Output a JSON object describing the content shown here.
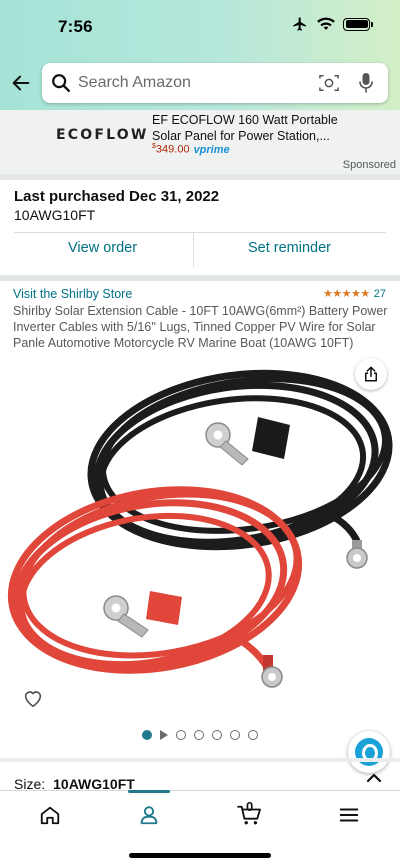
{
  "status_bar": {
    "time": "7:56",
    "icons": [
      "airplane-icon",
      "wifi-icon",
      "battery-icon"
    ]
  },
  "search": {
    "placeholder": "Search Amazon"
  },
  "ad": {
    "brand_logo": "ECOFLOW",
    "title": "EF ECOFLOW 160 Watt Portable Solar Panel for Power Station,...",
    "price_symbol": "$",
    "price": "349.00",
    "prime_label": "vprime",
    "sponsored_label": "Sponsored"
  },
  "last_purchase": {
    "title": "Last purchased Dec 31, 2022",
    "item": "10AWG10FT",
    "view_order": "View order",
    "set_reminder": "Set reminder"
  },
  "product": {
    "store_link": "Visit the Shirlby Store",
    "stars": "★★★★★",
    "rating": 4.6,
    "review_count": "27",
    "title": "Shirlby Solar Extension Cable - 10FT 10AWG(6mm²) Battery Power Inverter Cables with 5/16'' Lugs, Tinned Copper PV Wire for Solar Panle Automotive Motorcycle RV Marine Boat (10AWG 10FT)",
    "image_count": 6,
    "active_image": 0
  },
  "size": {
    "label": "Size:",
    "value": "10AWG10FT"
  },
  "tabbar": {
    "tabs": [
      "home-icon",
      "account-icon",
      "cart-icon",
      "menu-icon"
    ],
    "active_tab": "account-icon",
    "cart_count": "0"
  },
  "colors": {
    "link": "#007185",
    "price": "#b12704",
    "star": "#de7921",
    "accent": "#1f7a8c",
    "header_gradient": [
      "#a5e3d6",
      "#d3efc7"
    ]
  }
}
